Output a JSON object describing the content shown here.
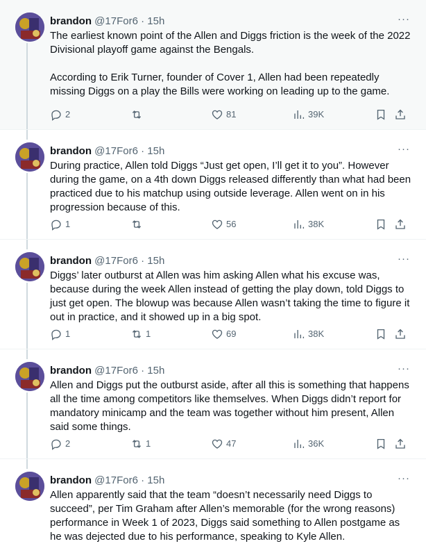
{
  "tweets": [
    {
      "name": "brandon",
      "handle": "@17For6",
      "dot": "·",
      "time": "15h",
      "more": "···",
      "text": "The earliest known point of the Allen and Diggs friction is the week of the 2022 Divisional playoff game against the Bengals.\n\nAccording to Erik Turner, founder of Cover 1, Allen had been repeatedly missing Diggs on a play the Bills were working on leading up to the game.",
      "replies": "2",
      "retweets": "",
      "likes": "81",
      "views": "39K"
    },
    {
      "name": "brandon",
      "handle": "@17For6",
      "dot": "·",
      "time": "15h",
      "more": "···",
      "text": "During practice, Allen told Diggs “Just get open, I’ll get it to you”. However during the game, on a 4th down Diggs released differently than what had been practiced due to his matchup using outside leverage. Allen went on in his progression because of this.",
      "replies": "1",
      "retweets": "",
      "likes": "56",
      "views": "38K"
    },
    {
      "name": "brandon",
      "handle": "@17For6",
      "dot": "·",
      "time": "15h",
      "more": "···",
      "text": "Diggs’ later outburst at Allen was him asking Allen what his excuse was, because during the week Allen instead of getting the play down, told Diggs to just get open. The blowup was because Allen wasn’t taking the time to figure it out in practice, and it showed up in a big spot.",
      "replies": "1",
      "retweets": "1",
      "likes": "69",
      "views": "38K"
    },
    {
      "name": "brandon",
      "handle": "@17For6",
      "dot": "·",
      "time": "15h",
      "more": "···",
      "text": "Allen and Diggs put the outburst aside, after all this is something that happens all the time among competitors like themselves. When Diggs didn’t report for mandatory minicamp and the team was together without him present, Allen said some things.",
      "replies": "2",
      "retweets": "1",
      "likes": "47",
      "views": "36K"
    },
    {
      "name": "brandon",
      "handle": "@17For6",
      "dot": "·",
      "time": "15h",
      "more": "···",
      "text": "Allen apparently said that the team “doesn’t necessarily need Diggs to succeed”, per Tim Graham after Allen’s memorable (for the wrong reasons) performance in Week 1 of 2023, Diggs said something to Allen postgame as he was dejected due to his performance, speaking to Kyle Allen."
    }
  ],
  "icons": {
    "reply": "reply-icon",
    "retweet": "retweet-icon",
    "like": "heart-icon",
    "views": "views-icon",
    "bookmark": "bookmark-icon",
    "share": "share-icon",
    "more": "more-icon"
  },
  "colors": {
    "text": "#0f1419",
    "secondary": "#536471",
    "border": "#eff3f4",
    "thread_line": "#cfd9de",
    "highlight_bg": "#f7f9f9"
  }
}
